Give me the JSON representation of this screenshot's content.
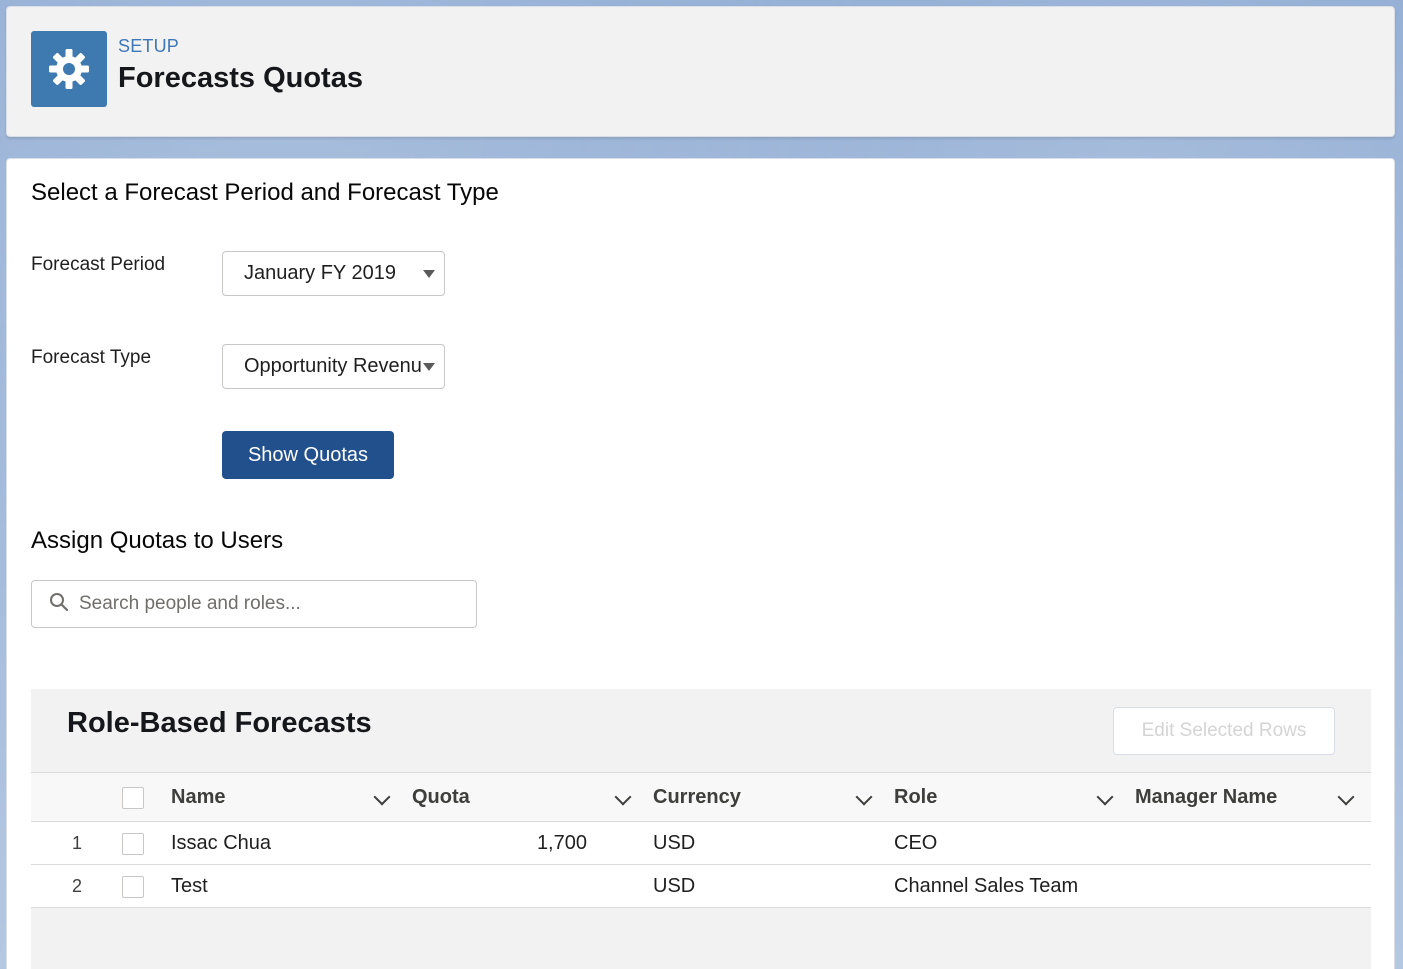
{
  "header": {
    "eyebrow": "SETUP",
    "title": "Forecasts Quotas",
    "icon": "gear-icon"
  },
  "period_section": {
    "title": "Select a Forecast Period and Forecast Type",
    "forecast_period_label": "Forecast Period",
    "forecast_period_value": "January FY 2019",
    "forecast_type_label": "Forecast Type",
    "forecast_type_value": "Opportunity Revenue",
    "show_quotas_label": "Show Quotas"
  },
  "assign_section": {
    "title": "Assign Quotas to Users",
    "search_placeholder": "Search people and roles..."
  },
  "table": {
    "title": "Role-Based Forecasts",
    "edit_selected_label": "Edit Selected Rows",
    "columns": [
      "Name",
      "Quota",
      "Currency",
      "Role",
      "Manager Name"
    ],
    "rows": [
      {
        "num": "1",
        "name": "Issac Chua",
        "quota": "1,700",
        "currency": "USD",
        "role": "CEO",
        "manager": ""
      },
      {
        "num": "2",
        "name": "Test",
        "quota": "",
        "currency": "USD",
        "role": "Channel Sales Team",
        "manager": ""
      }
    ]
  },
  "colors": {
    "brand_blue": "#22508c",
    "icon_bg": "#3e7ab0",
    "eyebrow": "#3e77b8"
  }
}
